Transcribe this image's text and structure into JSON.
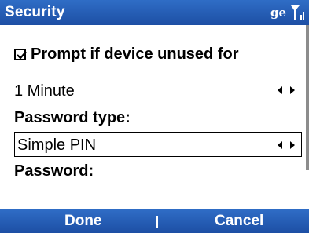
{
  "title_bar": {
    "title": "Security",
    "status_text": "ge",
    "signal_icon": "signal-bars-icon"
  },
  "form": {
    "checkbox": {
      "label": "Prompt if device unused for",
      "checked": true
    },
    "timeout": {
      "value": "1 Minute"
    },
    "password_type": {
      "label": "Password type:",
      "value": "Simple PIN"
    },
    "password": {
      "label": "Password:"
    }
  },
  "softkeys": {
    "left": "Done",
    "right": "Cancel"
  },
  "colors": {
    "bar": "#1d4fa4",
    "text": "#000000",
    "background": "#ffffff"
  }
}
